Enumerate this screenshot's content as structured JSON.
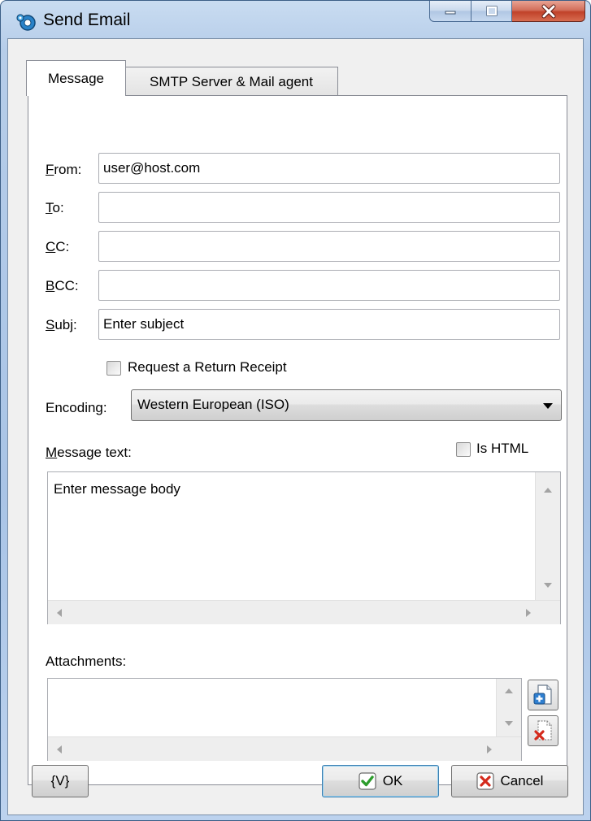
{
  "window": {
    "title": "Send Email"
  },
  "tabs": [
    {
      "label": "Message",
      "active": true
    },
    {
      "label": "SMTP Server & Mail agent",
      "active": false
    }
  ],
  "form": {
    "from": {
      "access_key": "F",
      "rest": "rom:",
      "value": "user@host.com"
    },
    "to": {
      "access_key": "T",
      "rest": "o:",
      "value": ""
    },
    "cc": {
      "access_key": "C",
      "rest": "C:",
      "value": ""
    },
    "bcc": {
      "access_key": "B",
      "rest": "CC:",
      "value": ""
    },
    "subj": {
      "access_key": "S",
      "rest": "ubj:",
      "value": "Enter subject"
    },
    "return_receipt": {
      "label": "Request a Return Receipt",
      "checked": false
    },
    "encoding": {
      "label": "Encoding:",
      "value": "Western European (ISO)"
    },
    "message": {
      "access_key": "M",
      "rest": "essage text:",
      "value": "Enter message body"
    },
    "is_html": {
      "label": "Is HTML",
      "checked": false
    },
    "attachments": {
      "label": "Attachments:"
    }
  },
  "buttons": {
    "variables": "{V}",
    "ok": "OK",
    "cancel": "Cancel"
  },
  "colors": {
    "ok_check": "#2c9c2c",
    "cancel_x": "#d42a1c",
    "close_button": "#c0422a"
  }
}
